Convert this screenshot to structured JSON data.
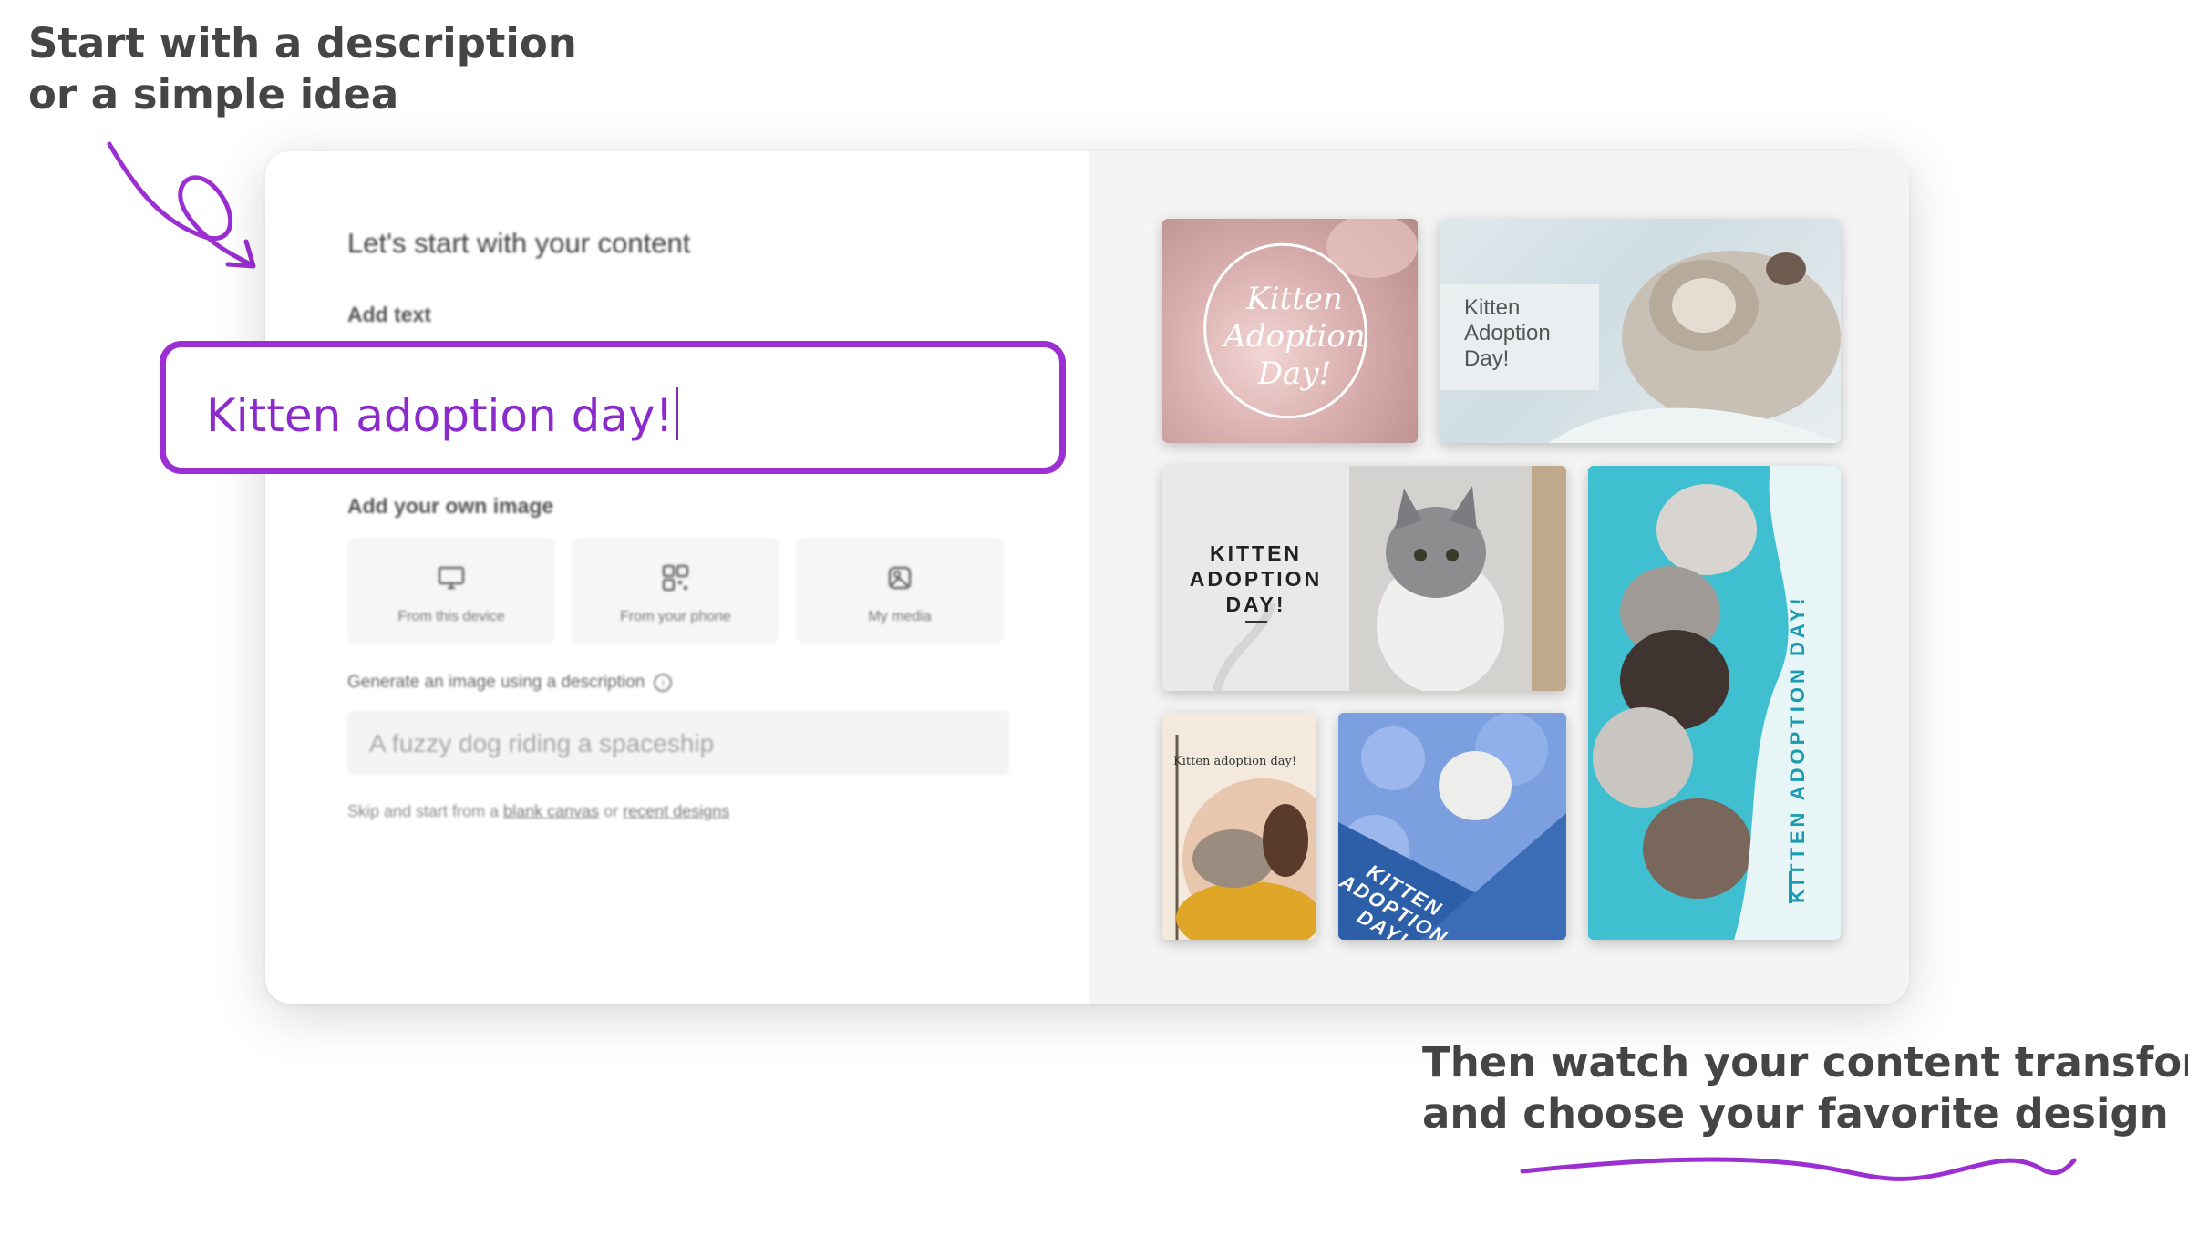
{
  "callouts": {
    "top_line1": "Start with a description",
    "top_line2": "or a simple idea",
    "bottom_line1": "Then watch your content transform",
    "bottom_line2": "and choose your favorite design"
  },
  "colors": {
    "accent": "#9b2fd2",
    "accent_text": "#8c2bcb"
  },
  "form": {
    "heading": "Let's start with your content",
    "add_text_label": "Add text",
    "text_value": "Kitten adoption day!",
    "add_image_label": "Add your own image",
    "image_sources": [
      {
        "label": "From this device",
        "icon": "monitor-icon"
      },
      {
        "label": "From your phone",
        "icon": "qr-code-icon"
      },
      {
        "label": "My media",
        "icon": "media-icon"
      }
    ],
    "generate_label": "Generate an image using a description",
    "generate_placeholder": "A fuzzy dog riding a spaceship",
    "skip_prefix": "Skip and start from a",
    "skip_link1": "blank canvas",
    "skip_or": "or",
    "skip_link2": "recent designs"
  },
  "designs": {
    "d1_text": "Kitten Adoption Day!",
    "d2_text": "Kitten Adoption Day!",
    "d3_text": "KITTEN ADOPTION DAY!",
    "d4_text": "KITTEN ADOPTION DAY!",
    "d5_text": "Kitten adoption day!",
    "d6_text": "KITTEN ADOPTION DAY!"
  }
}
